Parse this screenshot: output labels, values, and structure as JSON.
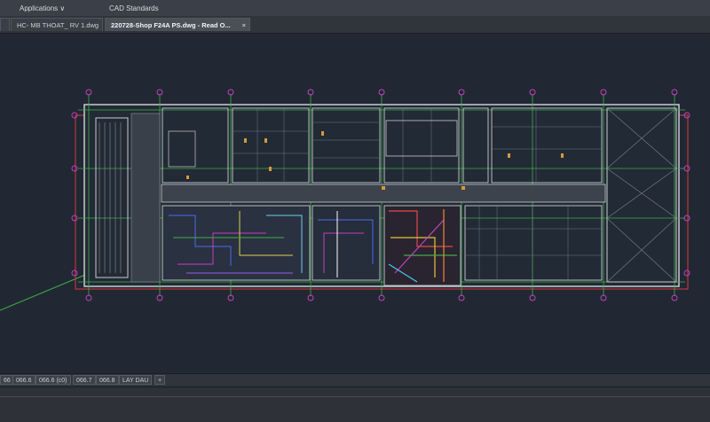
{
  "menubar": {
    "applications_label": "Applications",
    "applications_arrow": "∨",
    "cad_standards_label": "CAD Standards"
  },
  "tabs": {
    "first_label": "",
    "mb_label": "HC- MB THOAT_ RV 1.dwg",
    "active_label": "220728-Shop F24A PS.dwg - Read O...",
    "close_glyph": "×"
  },
  "layout_tabs": {
    "items": [
      "66",
      "066.6",
      "066.6 (c0)",
      "066.7",
      "066.8",
      "LAY DAU"
    ],
    "add_glyph": "+"
  },
  "colors": {
    "canvas": "#212833",
    "drawing_white": "#c9ccd0",
    "grid_green": "#3fae4a",
    "axis_magenta": "#c43fbf",
    "border_red": "#d23a3a"
  }
}
